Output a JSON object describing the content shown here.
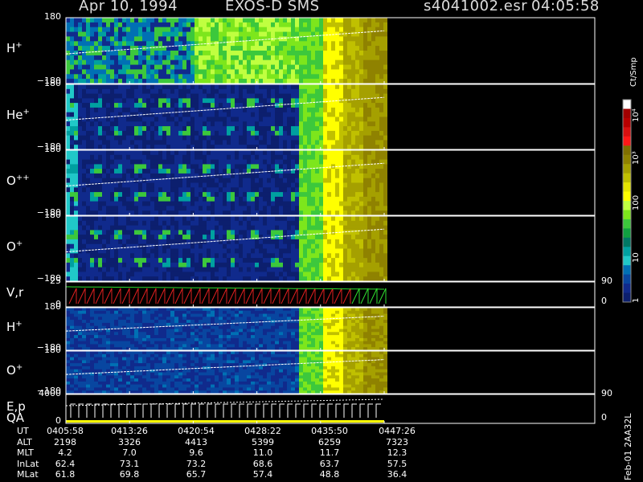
{
  "header": {
    "date": "Apr 10, 1994",
    "instrument": "EXOS-D SMS",
    "file": "s4041002.esr",
    "time": "04:05:58"
  },
  "panels": [
    {
      "name": "H",
      "sup": "+",
      "ytop": "180",
      "ybot": "−180"
    },
    {
      "name": "He",
      "sup": "+",
      "ytop": "180",
      "ybot": "−180"
    },
    {
      "name": "O",
      "sup": "++",
      "ytop": "180",
      "ybot": "−180"
    },
    {
      "name": "O",
      "sup": "+",
      "ytop": "180",
      "ybot": "−180"
    },
    {
      "name": "V,r",
      "sup": "",
      "ytop": "25",
      "ybot": "0",
      "rtop": "90",
      "rbot": "0"
    },
    {
      "name": "H",
      "sup": "+",
      "ytop": "180",
      "ybot": "−180"
    },
    {
      "name": "O",
      "sup": "+",
      "ytop": "180",
      "ybot": "−180"
    },
    {
      "name": "E,p",
      "name2": "QA",
      "sup": "",
      "ytop": "4000",
      "ybot": "0",
      "rtop": "90",
      "rbot": "0"
    }
  ],
  "colorbar": {
    "unit": "Ct/Smp",
    "labels": [
      "10⁴",
      "10³",
      "100",
      "10",
      "1"
    ],
    "colors": [
      "#ffffff",
      "#a00000",
      "#b80000",
      "#d81010",
      "#ff1818",
      "#806f00",
      "#8f8200",
      "#a5a000",
      "#c0c000",
      "#e5e500",
      "#ffff00",
      "#c0ff40",
      "#7de61c",
      "#3cc83c",
      "#10a040",
      "#007864",
      "#00a0a0",
      "#20c8c8",
      "#0070b4",
      "#0846a0",
      "#102a8c",
      "#0c1f6e"
    ]
  },
  "footer": {
    "side_label": "Feb-01 2AA32L",
    "rows": [
      {
        "label": "UT",
        "values": [
          "0405:58",
          "0413:26",
          "0420:54",
          "0428:22",
          "0435:50",
          "0447:26"
        ]
      },
      {
        "label": "ALT",
        "values": [
          "2198",
          "3326",
          "4413",
          "5399",
          "6259",
          "7323"
        ]
      },
      {
        "label": "MLT",
        "values": [
          "4.2",
          "7.0",
          "9.6",
          "11.0",
          "11.7",
          "12.3"
        ]
      },
      {
        "label": "InLat",
        "values": [
          "62.4",
          "73.1",
          "73.2",
          "68.6",
          "63.7",
          "57.5"
        ]
      },
      {
        "label": "MLat",
        "values": [
          "61.8",
          "69.8",
          "65.7",
          "57.4",
          "48.8",
          "36.4"
        ]
      }
    ]
  },
  "chart_data": {
    "type": "heatmap",
    "x_ticks": [
      "0405:58",
      "0413:26",
      "0420:54",
      "0428:22",
      "0435:50",
      "0447:26"
    ],
    "colorbar_range": [
      "1",
      "10⁴"
    ]
  }
}
